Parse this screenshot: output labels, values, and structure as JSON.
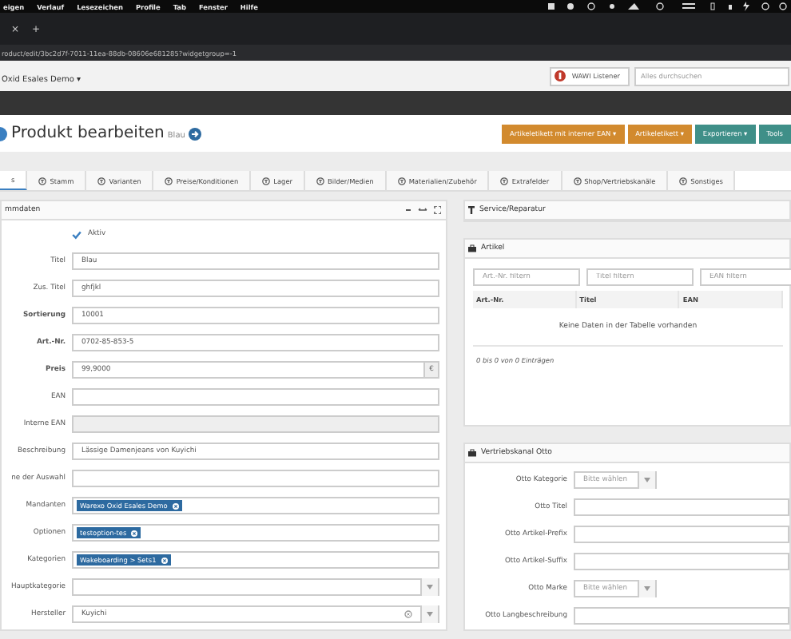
{
  "menu_bar": {
    "items": [
      "eigen",
      "Verlauf",
      "Lesezeichen",
      "Profile",
      "Tab",
      "Fenster",
      "Hilfe"
    ]
  },
  "browser": {
    "tab_close": "×",
    "new_tab": "+",
    "url": "roduct/edit/3bc2d7f-7011-11ea-88db-08606e681285?widgetgroup=-1"
  },
  "app_header": {
    "client": "Oxid Esales Demo ▾",
    "listener_button": "WAWI Listener",
    "search": {
      "placeholder": "Alles durchsuchen"
    }
  },
  "page": {
    "title": "Produkt bearbeiten",
    "subtitle": "Blau",
    "actions": [
      {
        "label": "Artikeletikett mit interner EAN ▾",
        "color": "#d28a2e"
      },
      {
        "label": "Artikeletikett ▾",
        "color": "#d28a2e"
      },
      {
        "label": "Exportieren ▾",
        "color": "#3f8f88"
      },
      {
        "label": "Tools",
        "color": "#3f8f88"
      }
    ]
  },
  "tabs": [
    {
      "label": "s",
      "selected": true
    },
    {
      "label": "Stamm",
      "selected": false
    },
    {
      "label": "Varianten",
      "selected": false
    },
    {
      "label": "Preise/Konditionen",
      "selected": false
    },
    {
      "label": "Lager",
      "selected": false
    },
    {
      "label": "Bilder/Medien",
      "selected": false
    },
    {
      "label": "Materialien/Zubehör",
      "selected": false
    },
    {
      "label": "Extrafelder",
      "selected": false
    },
    {
      "label": "Shop/Vertriebskanäle",
      "selected": false
    },
    {
      "label": "Sonstiges",
      "selected": false
    }
  ],
  "stammdaten": {
    "title": "mmdaten",
    "fields": [
      {
        "kind": "checkbox",
        "label": "Aktiv",
        "checked": true
      },
      {
        "kind": "text",
        "label": "Titel",
        "value": "Blau"
      },
      {
        "kind": "text",
        "label": "Zus. Titel",
        "value": "ghfjkl"
      },
      {
        "kind": "text",
        "label": "Sortierung",
        "value": "10001",
        "bold": true
      },
      {
        "kind": "text",
        "label": "Art.-Nr.",
        "value": "0702-85-853-5",
        "bold": true
      },
      {
        "kind": "price",
        "label": "Preis",
        "value": "99,9000",
        "unit": "€",
        "bold": true
      },
      {
        "kind": "text",
        "label": "EAN"
      },
      {
        "kind": "disabled",
        "label": "Interne EAN"
      },
      {
        "kind": "text",
        "label": "Beschreibung",
        "value": "Lässige Damenjeans von Kuyichi"
      },
      {
        "kind": "text",
        "label": "ne der Auswahl"
      },
      {
        "kind": "tags",
        "label": "Mandanten",
        "tags": [
          "Warexo Oxid Esales Demo"
        ]
      },
      {
        "kind": "tags",
        "label": "Optionen",
        "tags": [
          "testoption-tes"
        ]
      },
      {
        "kind": "tags",
        "label": "Kategorien",
        "tags": [
          "Wakeboarding > Sets1"
        ]
      },
      {
        "kind": "select",
        "label": "Hauptkategorie"
      },
      {
        "kind": "select-clear",
        "label": "Hersteller",
        "value": "Kuyichi"
      }
    ]
  },
  "service_panel": {
    "title": "Service/Reparatur"
  },
  "artikel_panel": {
    "title": "Artikel",
    "filters": [
      {
        "placeholder": "Art.-Nr. filtern"
      },
      {
        "placeholder": "Titel filtern"
      },
      {
        "placeholder": "EAN filtern"
      }
    ],
    "columns": [
      "Art.-Nr.",
      "Titel",
      "EAN"
    ],
    "empty": "Keine Daten in der Tabelle vorhanden",
    "info": "0 bis 0 von 0 Einträgen"
  },
  "otto_panel": {
    "title": "Vertriebskanal Otto",
    "fields": [
      {
        "kind": "select",
        "label": "Otto Kategorie",
        "placeholder": "Bitte wählen"
      },
      {
        "kind": "text",
        "label": "Otto Titel"
      },
      {
        "kind": "text",
        "label": "Otto Artikel-Prefix"
      },
      {
        "kind": "text",
        "label": "Otto Artikel-Suffix"
      },
      {
        "kind": "select",
        "label": "Otto Marke",
        "placeholder": "Bitte wählen"
      },
      {
        "kind": "text",
        "label": "Otto Langbeschreibung"
      }
    ]
  }
}
